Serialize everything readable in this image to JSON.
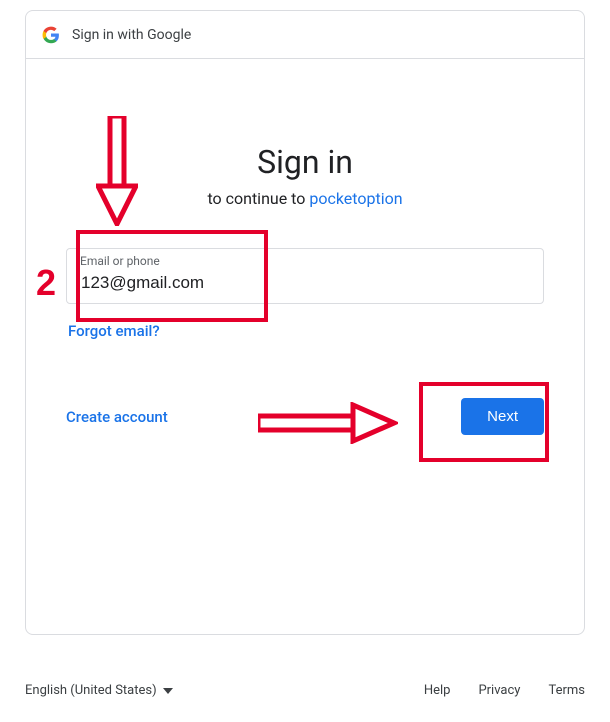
{
  "header": {
    "title": "Sign in with Google"
  },
  "main": {
    "title": "Sign in",
    "subtitle_prefix": "to continue to ",
    "app_name": "pocketoption",
    "email_label": "Email or phone",
    "email_value": "123@gmail.com",
    "forgot_email": "Forgot email?",
    "create_account": "Create account",
    "next": "Next"
  },
  "footer": {
    "language": "English (United States)",
    "help": "Help",
    "privacy": "Privacy",
    "terms": "Terms"
  },
  "annotations": {
    "step_number": "2"
  }
}
